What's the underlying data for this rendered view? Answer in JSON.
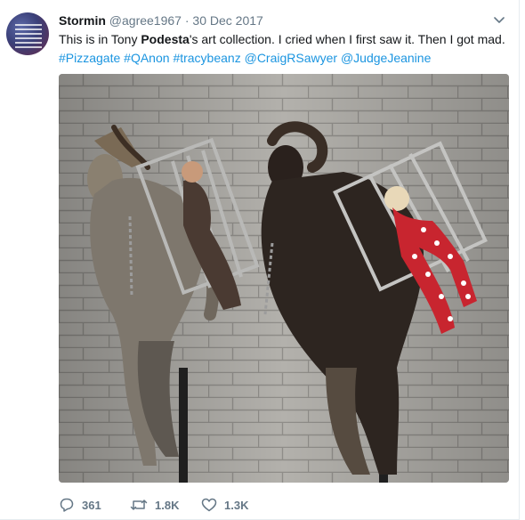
{
  "tweet": {
    "user_name": "Stormin",
    "handle": "@agree1967",
    "separator": "·",
    "date": "30 Dec 2017",
    "text_part1": "This is in Tony ",
    "text_bold": "Podesta",
    "text_part2": "'s art collection. I cried when I first saw it. Then I got mad.",
    "hashtags": [
      "#Pizzagate",
      "#QAnon",
      "#tracybeanz",
      "@CraigRSawyer",
      "@JudgeJeanine"
    ]
  },
  "actions": {
    "replies": "361",
    "retweets": "1.8K",
    "likes": "1.3K"
  },
  "icons": {
    "menu": "chevron-down-icon",
    "reply": "reply-icon",
    "retweet": "retweet-icon",
    "like": "heart-icon"
  },
  "colors": {
    "link": "#1b95e0",
    "secondary_text": "#657786",
    "primary_text": "#14171a",
    "border": "#e6ecf0"
  }
}
